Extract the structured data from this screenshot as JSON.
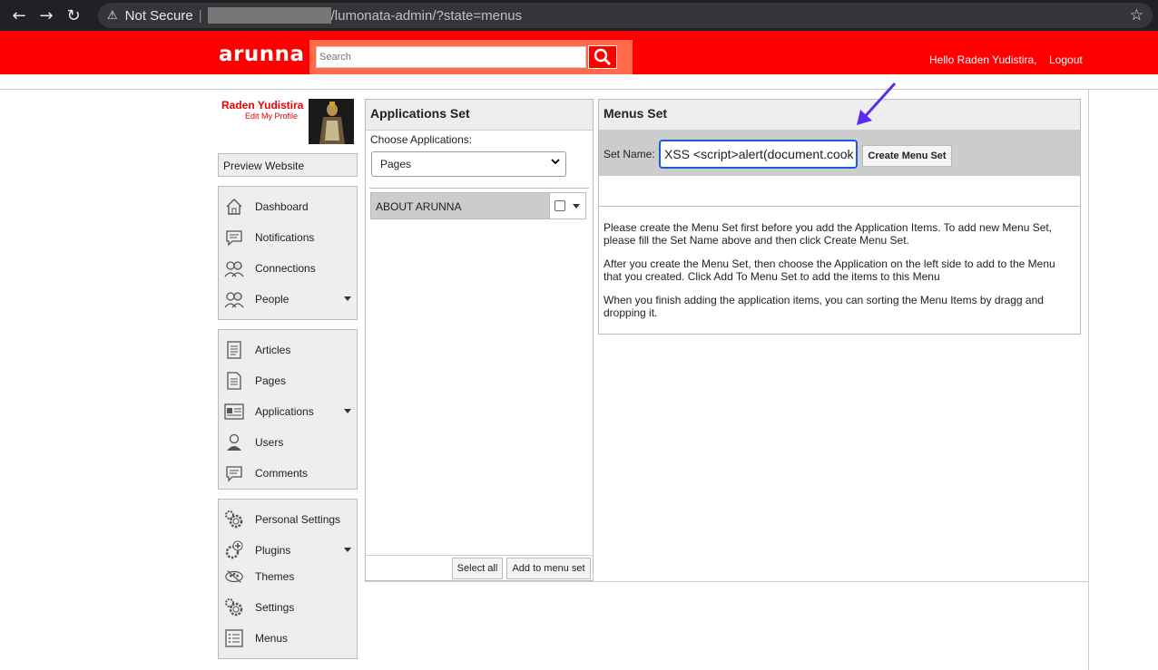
{
  "browser": {
    "security_label": "Not Secure",
    "url_path": "/lumonata-admin/?state=menus"
  },
  "header": {
    "logo": "arunna",
    "search_placeholder": "Search",
    "greeting": "Hello Raden Yudistira,",
    "logout": "Logout"
  },
  "profile": {
    "name": "Raden Yudistira",
    "edit_link": "Edit My Profile"
  },
  "sidebar": {
    "preview": "Preview Website",
    "group1": [
      {
        "label": "Dashboard",
        "icon": "home-icon"
      },
      {
        "label": "Notifications",
        "icon": "speech-bubble-icon"
      },
      {
        "label": "Connections",
        "icon": "people-pair-icon"
      },
      {
        "label": "People",
        "icon": "people-pair-icon"
      }
    ],
    "group2": [
      {
        "label": "Articles",
        "icon": "document-icon"
      },
      {
        "label": "Pages",
        "icon": "pages-icon"
      },
      {
        "label": "Applications",
        "icon": "applications-icon"
      },
      {
        "label": "Users",
        "icon": "user-icon"
      },
      {
        "label": "Comments",
        "icon": "comment-icon"
      }
    ],
    "group3": [
      {
        "label": "Personal Settings",
        "icon": "gears-icon"
      },
      {
        "label": "Plugins",
        "icon": "plugin-gear-icon"
      },
      {
        "label": "Themes",
        "icon": "palette-icon"
      },
      {
        "label": "Settings",
        "icon": "gears-icon"
      },
      {
        "label": "Menus",
        "icon": "list-icon"
      }
    ]
  },
  "applications_set": {
    "title": "Applications Set",
    "choose_label": "Choose Applications:",
    "selected": "Pages",
    "items": [
      {
        "label": "ABOUT ARUNNA"
      }
    ],
    "select_all": "Select all",
    "add_to_menu": "Add to menu set"
  },
  "menus_set": {
    "title": "Menus Set",
    "set_name_label": "Set Name:",
    "set_name_value": "XSS <script>alert(document.cook",
    "create_button": "Create Menu Set",
    "info1": "Please create the Menu Set first before you add the Application Items. To add new Menu Set, please fill the Set Name above and then click Create Menu Set.",
    "info2": "After you create the Menu Set, then choose the Application on the left side to add to the Menu that you created. Click Add To Menu Set to add the items to this Menu",
    "info3": "When you finish adding the application items, you can sorting the Menu Items by dragg and dropping it."
  },
  "colors": {
    "header_red": "#ff0000",
    "search_orange": "#ff6b4a",
    "annotation_arrow": "#5b2bf0"
  }
}
